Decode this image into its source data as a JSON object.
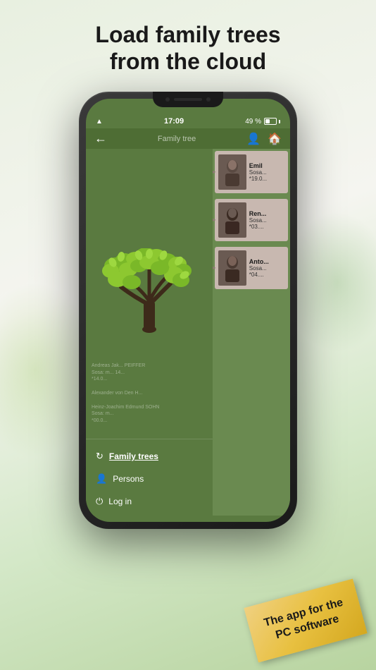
{
  "headline": {
    "line1": "Load family trees",
    "line2": "from the cloud"
  },
  "status_bar": {
    "wifi": "▲",
    "time": "17:09",
    "battery_pct": "49 %"
  },
  "nav": {
    "back_icon": "←",
    "title": "Family tree",
    "person_icon": "👤",
    "home_icon": "🏠"
  },
  "menu": {
    "items": [
      {
        "id": "family-trees",
        "icon": "↻",
        "label": "Family trees",
        "active": true
      },
      {
        "id": "persons",
        "icon": "👤",
        "label": "Persons",
        "active": false
      },
      {
        "id": "login",
        "icon": "⏻",
        "label": "Log in",
        "active": false
      }
    ]
  },
  "persons": [
    {
      "name": "Emil",
      "detail1": "Sosa...",
      "detail2": "*19.0..."
    },
    {
      "name": "Ren...",
      "detail1": "Sosa...",
      "detail2": "*03...."
    },
    {
      "name": "Anto...",
      "detail1": "Sosa...",
      "detail2": "*04...."
    }
  ],
  "bg_text": {
    "line1": "Andreas Jak... PEIFFER",
    "line2": "Sosa: m... 14...",
    "line3": "*14.0...",
    "line4": "Alexander von Den H...",
    "line5": "Heinz-Joachim Edmund SOHN",
    "line6": "Sosa: m...",
    "line7": "*00.0..."
  },
  "banner": {
    "line1": "The app for the",
    "line2": "PC software"
  }
}
